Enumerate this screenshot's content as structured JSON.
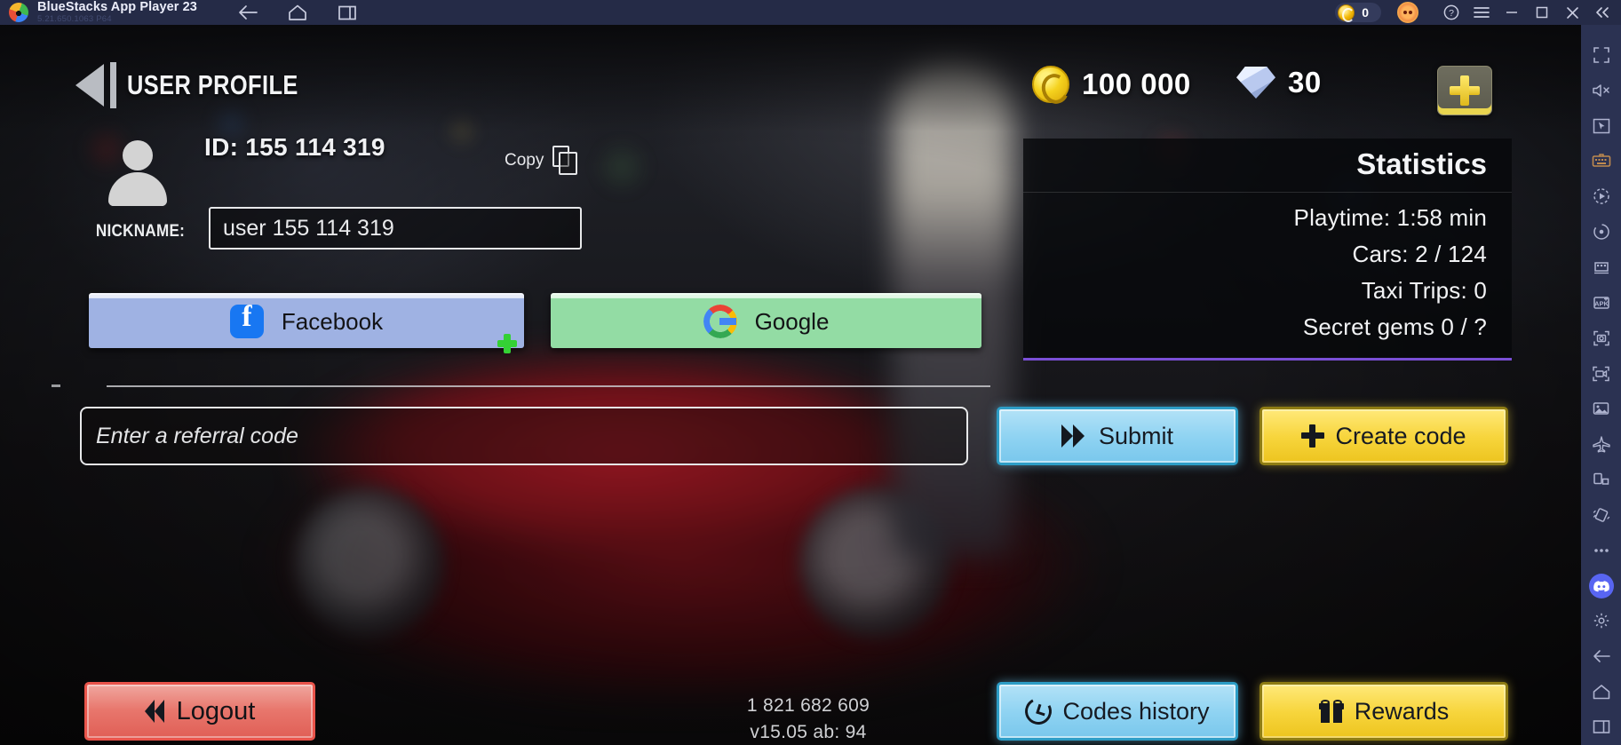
{
  "bluestacks": {
    "app_title": "BlueStacks App Player 23",
    "version": "5.21.650.1063  P64",
    "nav_icons": [
      "back-icon",
      "home-icon",
      "multi-instance-icon"
    ],
    "coin_count": "0",
    "window_controls": [
      "help-icon",
      "menu-icon",
      "minimize-icon",
      "maximize-icon",
      "close-icon",
      "collapse-icon"
    ],
    "sidebar_icons": [
      "fullscreen-icon",
      "mute-icon",
      "cursor-pointer-icon",
      "keyboard-controls-icon",
      "macro-record-icon",
      "rotate-icon",
      "multi-instance-manager-icon",
      "install-apk-icon",
      "screenshot-icon",
      "screen-record-icon",
      "media-manager-icon",
      "airplane-mode-icon",
      "rotate-screen-icon",
      "shake-icon",
      "more-options-icon",
      "discord-icon",
      "settings-icon",
      "back-icon",
      "home-icon",
      "recents-icon"
    ]
  },
  "game": {
    "header": {
      "back_icon": "back-arrow-icon",
      "title": "USER PROFILE",
      "coins": "100 000",
      "gems": "30",
      "add_button": "plus-icon"
    },
    "profile": {
      "avatar_icon": "user-avatar-icon",
      "id_label": "ID: 155 114 319",
      "copy_label": "Copy",
      "copy_icon": "copy-icon",
      "nickname_label": "NICKNAME:",
      "nickname_value": "user 155 114 319"
    },
    "social": {
      "facebook_label": "Facebook",
      "facebook_icon": "facebook-icon",
      "google_label": "Google",
      "google_icon": "google-icon"
    },
    "referral": {
      "placeholder": "Enter a referral code",
      "value": "",
      "submit_label": "Submit",
      "submit_icon": "double-chevron-right-icon",
      "create_label": "Create code",
      "create_icon": "plus-icon"
    },
    "footer": {
      "logout_label": "Logout",
      "logout_icon": "double-chevron-left-icon",
      "build_number": "1 821 682 609",
      "build_version": "v15.05 ab: 94",
      "codes_history_label": "Codes history",
      "codes_history_icon": "history-clock-icon",
      "rewards_label": "Rewards",
      "rewards_icon": "gift-icon"
    },
    "statistics": {
      "title": "Statistics",
      "rows": [
        "Playtime: 1:58 min",
        "Cars: 2 / 124",
        "Taxi Trips: 0",
        "Secret gems 0 / ?"
      ]
    }
  },
  "colors": {
    "titlebar_bg": "#252b47",
    "sidebar_bg": "#2b3252",
    "accent_cyan": "#8fd3f2",
    "accent_yellow": "#f7d53c",
    "accent_red": "#e8766c",
    "stats_underline": "#7a4fd6"
  }
}
